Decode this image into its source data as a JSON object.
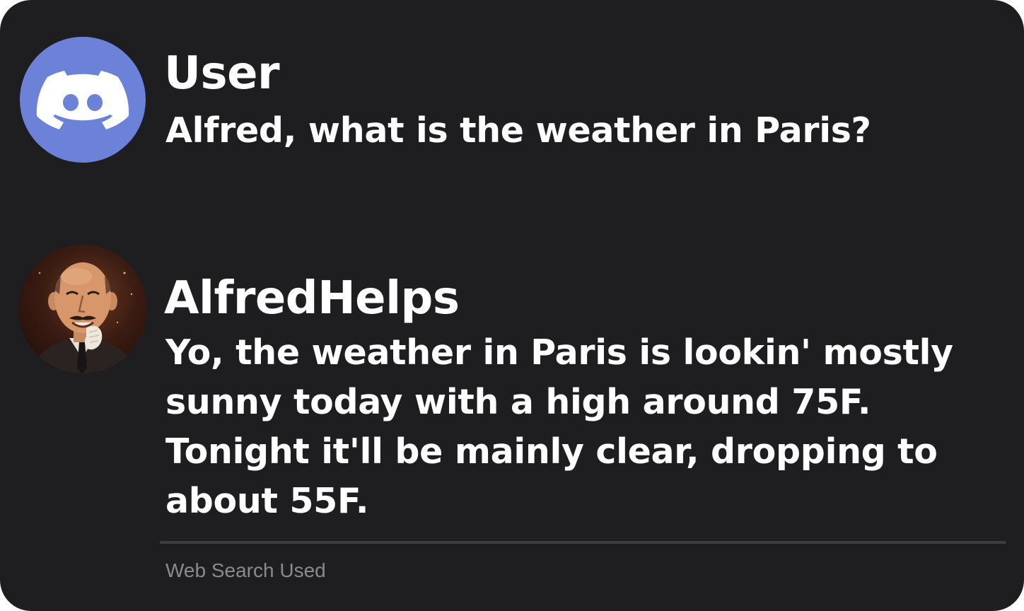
{
  "colors": {
    "background": "#1e1e20",
    "discord_blurple": "#6b82d8",
    "text": "#ffffff",
    "muted_text": "#8a8a8c",
    "divider": "#3c3c40"
  },
  "messages": [
    {
      "avatar_icon": "discord-logo-icon",
      "username": "User",
      "text": "Alfred, what is the weather in Paris?"
    },
    {
      "avatar_icon": "alfred-portrait-avatar",
      "username": "AlfredHelps",
      "text": "Yo, the weather in Paris is lookin' mostly sunny today with a high around 75F. Tonight it'll be mainly clear, dropping to about 55F."
    }
  ],
  "footer": {
    "label": "Web Search Used"
  }
}
